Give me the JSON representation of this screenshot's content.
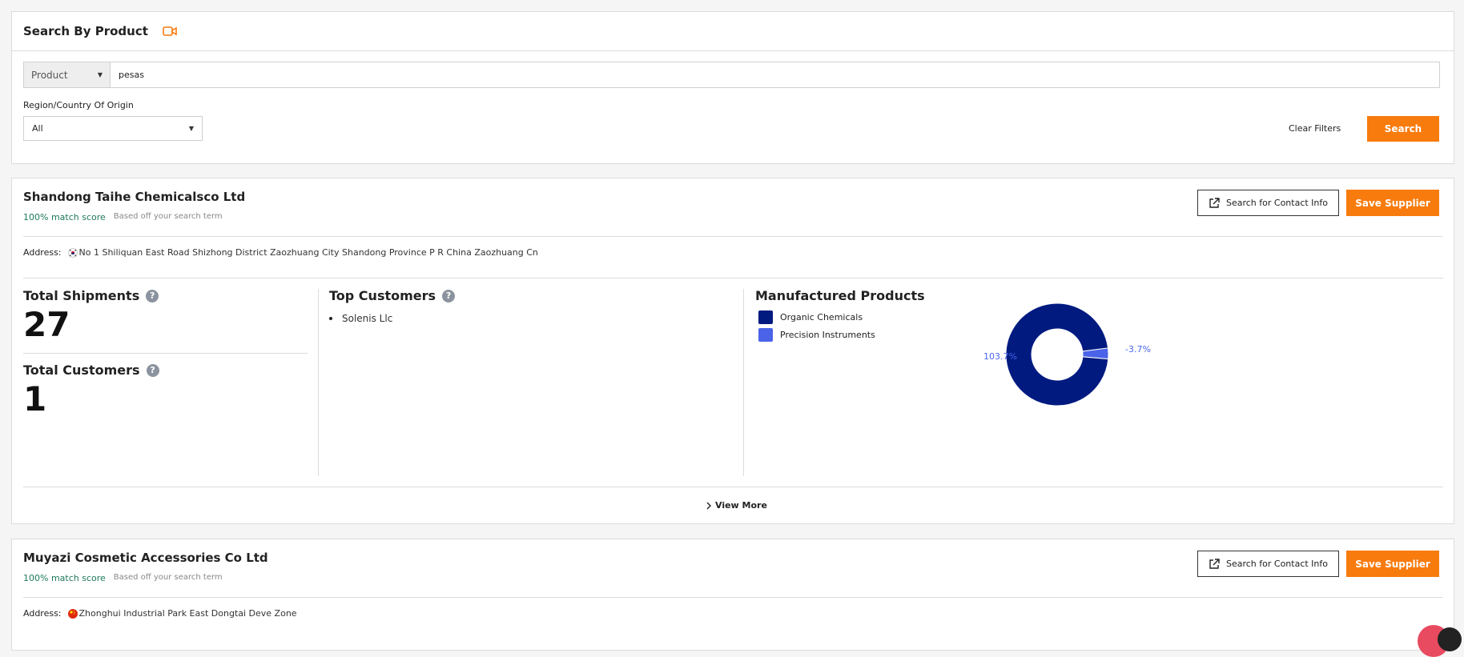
{
  "search": {
    "title": "Search By Product",
    "field_type": "Product",
    "query": "pesas",
    "region_label": "Region/Country Of Origin",
    "region_value": "All",
    "clear_label": "Clear Filters",
    "search_label": "Search",
    "accent_color": "#f87b0e"
  },
  "suppliers": [
    {
      "name": "Shandong Taihe Chemicalsco Ltd",
      "match_score": "100% match score",
      "match_note": "Based off your search term",
      "contact_label": "Search for Contact Info",
      "save_label": "Save Supplier",
      "address_label": "Address:",
      "address": "No 1 Shiliquan East Road Shizhong District Zaozhuang City Shandong Province P R China Zaozhuang Cn",
      "flag_icon": "korea-flag-icon",
      "total_shipments_label": "Total Shipments",
      "total_shipments": "27",
      "total_customers_label": "Total Customers",
      "total_customers": "1",
      "top_customers_label": "Top Customers",
      "top_customers": [
        "Solenis Llc"
      ],
      "products_label": "Manufactured Products",
      "view_more_label": "View More"
    },
    {
      "name": "Muyazi Cosmetic Accessories Co Ltd",
      "match_score": "100% match score",
      "match_note": "Based off your search term",
      "contact_label": "Search for Contact Info",
      "save_label": "Save Supplier",
      "address_label": "Address:",
      "address": "Zhonghui Industrial Park East Dongtai Deve Zone",
      "flag_icon": "china-flag-icon"
    }
  ],
  "chart_data": {
    "type": "pie",
    "categories": [
      "Organic Chemicals",
      "Precision Instruments"
    ],
    "values": [
      103.7,
      -3.7
    ],
    "data_labels": [
      "103.7%",
      "-3.7%"
    ],
    "colors": [
      "#001a80",
      "#4a63e8"
    ],
    "legend": "left"
  }
}
